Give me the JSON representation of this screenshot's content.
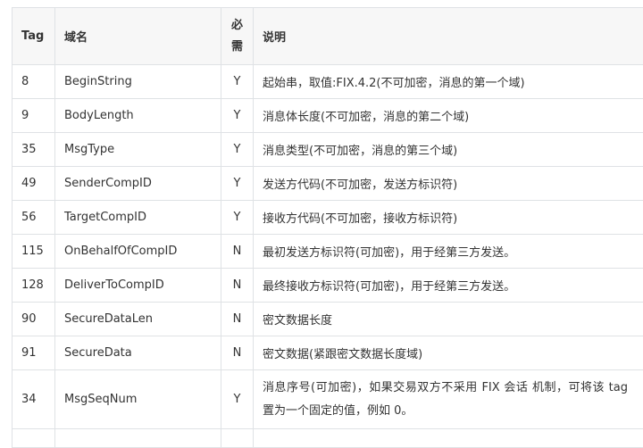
{
  "table": {
    "headers": {
      "tag": "Tag",
      "name": "域名",
      "required_line1": "必",
      "required_line2": "需",
      "desc": "说明"
    },
    "rows": [
      {
        "tag": "8",
        "name": "BeginString",
        "required": "Y",
        "desc": "起始串，取值:FIX.4.2(不可加密，消息的第一个域)"
      },
      {
        "tag": "9",
        "name": "BodyLength",
        "required": "Y",
        "desc": "消息体长度(不可加密，消息的第二个域)"
      },
      {
        "tag": "35",
        "name": "MsgType",
        "required": "Y",
        "desc": "消息类型(不可加密，消息的第三个域)"
      },
      {
        "tag": "49",
        "name": "SenderCompID",
        "required": "Y",
        "desc": "发送方代码(不可加密，发送方标识符)"
      },
      {
        "tag": "56",
        "name": "TargetCompID",
        "required": "Y",
        "desc": "接收方代码(不可加密，接收方标识符)"
      },
      {
        "tag": "115",
        "name": "OnBehalfOfCompID",
        "required": "N",
        "desc": "最初发送方标识符(可加密)，用于经第三方发送。"
      },
      {
        "tag": "128",
        "name": "DeliverToCompID",
        "required": "N",
        "desc": "最终接收方标识符(可加密)，用于经第三方发送。"
      },
      {
        "tag": "90",
        "name": "SecureDataLen",
        "required": "N",
        "desc": "密文数据长度"
      },
      {
        "tag": "91",
        "name": "SecureData",
        "required": "N",
        "desc": "密文数据(紧跟密文数据长度域)"
      },
      {
        "tag": "34",
        "name": "MsgSeqNum",
        "required": "Y",
        "desc": "消息序号(可加密)，如果交易双方不采用 FIX 会话 机制，可将该 tag 置为一个固定的值，例如 0。"
      }
    ]
  }
}
